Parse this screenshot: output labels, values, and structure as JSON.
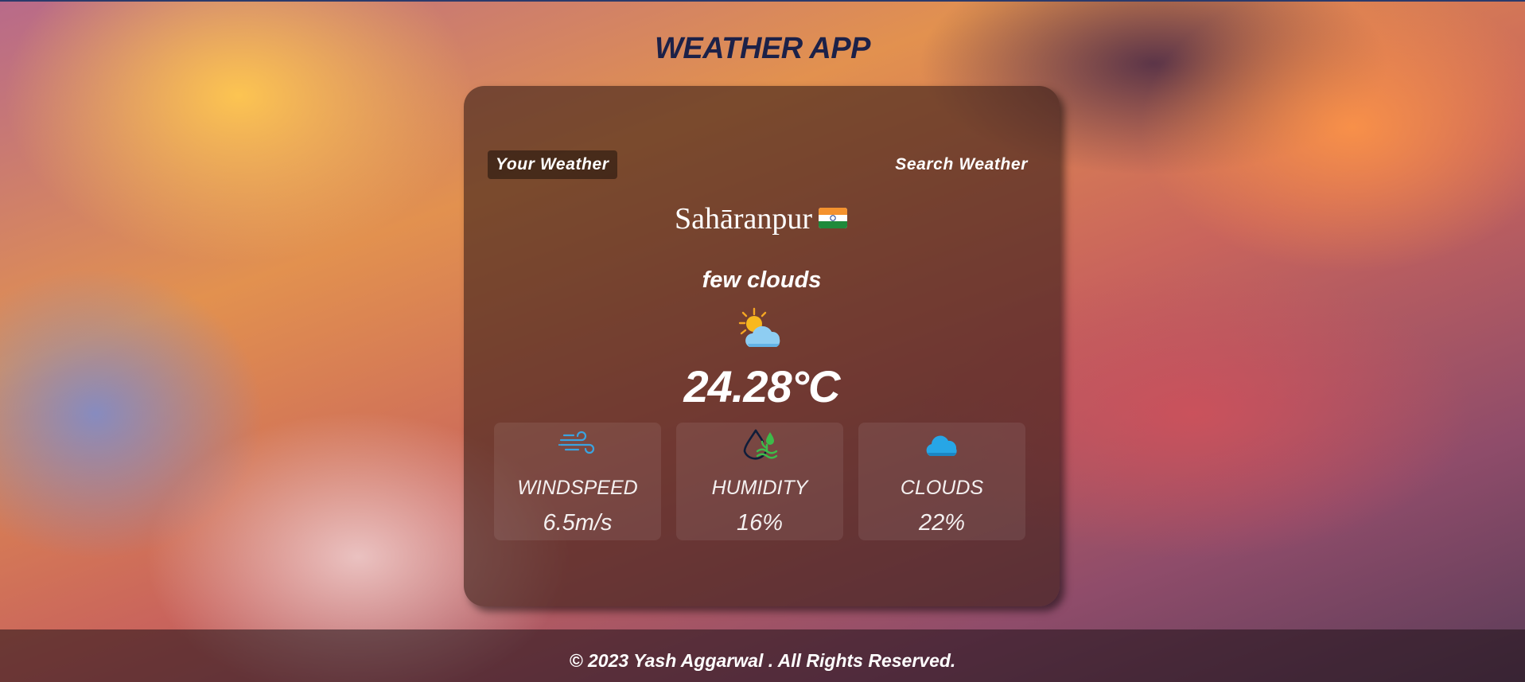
{
  "app": {
    "title": "WEATHER APP"
  },
  "tabs": [
    {
      "label": "Your Weather",
      "active": true
    },
    {
      "label": "Search Weather",
      "active": false
    }
  ],
  "weather": {
    "city": "Sahāranpur",
    "flag_icon": "india-flag-icon",
    "description": "few clouds",
    "condition_icon": "sun-behind-cloud-icon",
    "temperature": "24.28°C"
  },
  "stats": [
    {
      "icon": "wind-icon",
      "label": "WINDSPEED",
      "value": "6.5m/s"
    },
    {
      "icon": "humidity-icon",
      "label": "HUMIDITY",
      "value": "16%"
    },
    {
      "icon": "cloud-icon",
      "label": "CLOUDS",
      "value": "22%"
    }
  ],
  "footer": {
    "text": "© 2023 Yash Aggarwal . All Rights Reserved."
  },
  "colors": {
    "title": "#1c2148",
    "card": "#3a1e18",
    "text": "#ffffff"
  }
}
